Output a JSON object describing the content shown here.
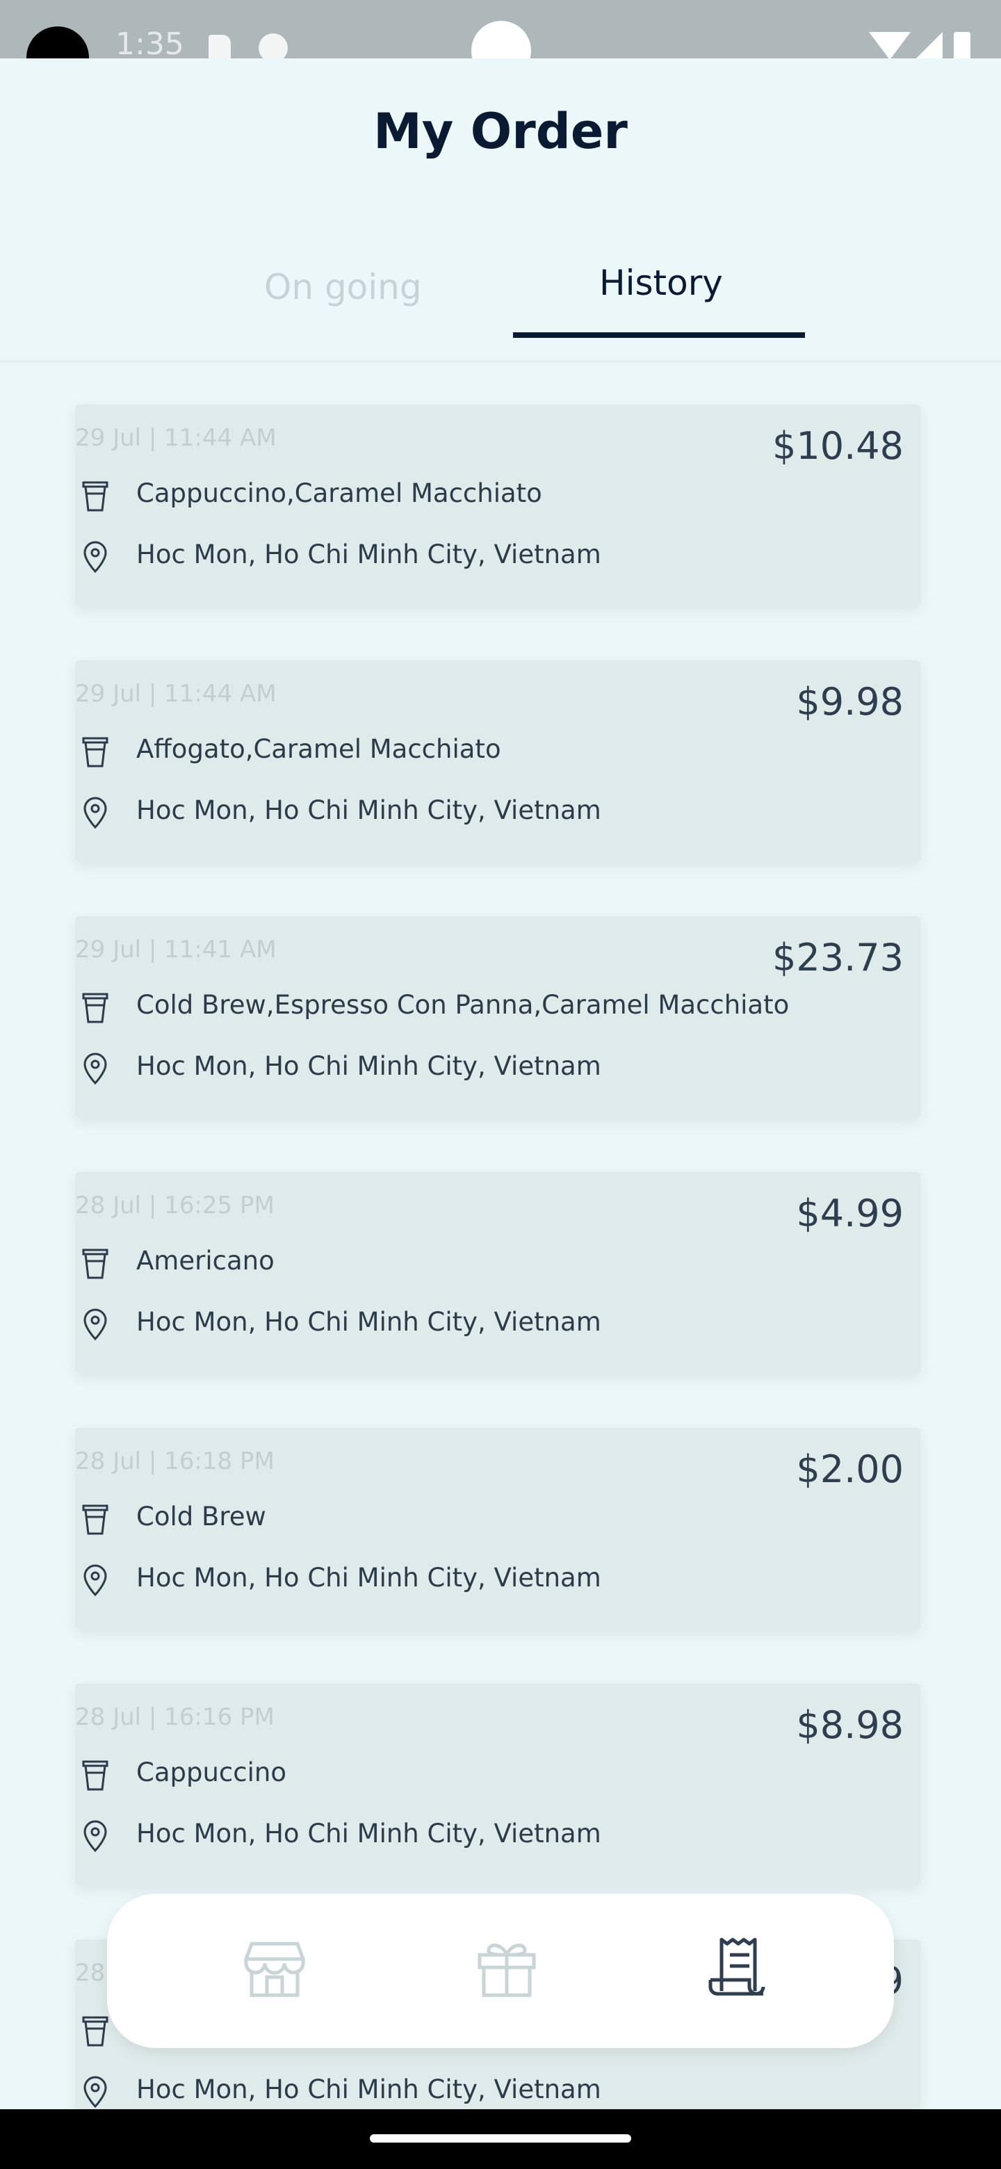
{
  "status_bar": {
    "time": "1:35"
  },
  "header": {
    "title": "My Order"
  },
  "tabs": [
    {
      "label": "On going",
      "active": false
    },
    {
      "label": "History",
      "active": true
    }
  ],
  "orders": [
    {
      "date": "29 Jul | 11:44 AM",
      "price": "$10.48",
      "items": "Cappuccino,Caramel Macchiato",
      "address": "Hoc Mon, Ho Chi Minh City, Vietnam"
    },
    {
      "date": "29 Jul | 11:44 AM",
      "price": "$9.98",
      "items": "Affogato,Caramel Macchiato",
      "address": "Hoc Mon, Ho Chi Minh City, Vietnam"
    },
    {
      "date": "29 Jul | 11:41 AM",
      "price": "$23.73",
      "items": "Cold Brew,Espresso Con Panna,Caramel Macchiato",
      "address": "Hoc Mon, Ho Chi Minh City, Vietnam"
    },
    {
      "date": "28 Jul | 16:25 PM",
      "price": "$4.99",
      "items": "Americano",
      "address": "Hoc Mon, Ho Chi Minh City, Vietnam"
    },
    {
      "date": "28 Jul | 16:18 PM",
      "price": "$2.00",
      "items": "Cold Brew",
      "address": "Hoc Mon, Ho Chi Minh City, Vietnam"
    },
    {
      "date": "28 Jul | 16:16 PM",
      "price": "$8.98",
      "items": "Cappuccino",
      "address": "Hoc Mon, Ho Chi Minh City, Vietnam"
    },
    {
      "date": "28",
      "price": "9",
      "items": "",
      "address": "Hoc Mon, Ho Chi Minh City, Vietnam"
    }
  ],
  "bottom_nav": [
    {
      "icon": "store-icon",
      "active": false
    },
    {
      "icon": "gift-icon",
      "active": false
    },
    {
      "icon": "receipt-icon",
      "active": true
    }
  ],
  "colors": {
    "background": "#ecf7f9",
    "card": "#dfeaea",
    "primary": "#0b1a33",
    "muted": "#c5d3d6"
  }
}
